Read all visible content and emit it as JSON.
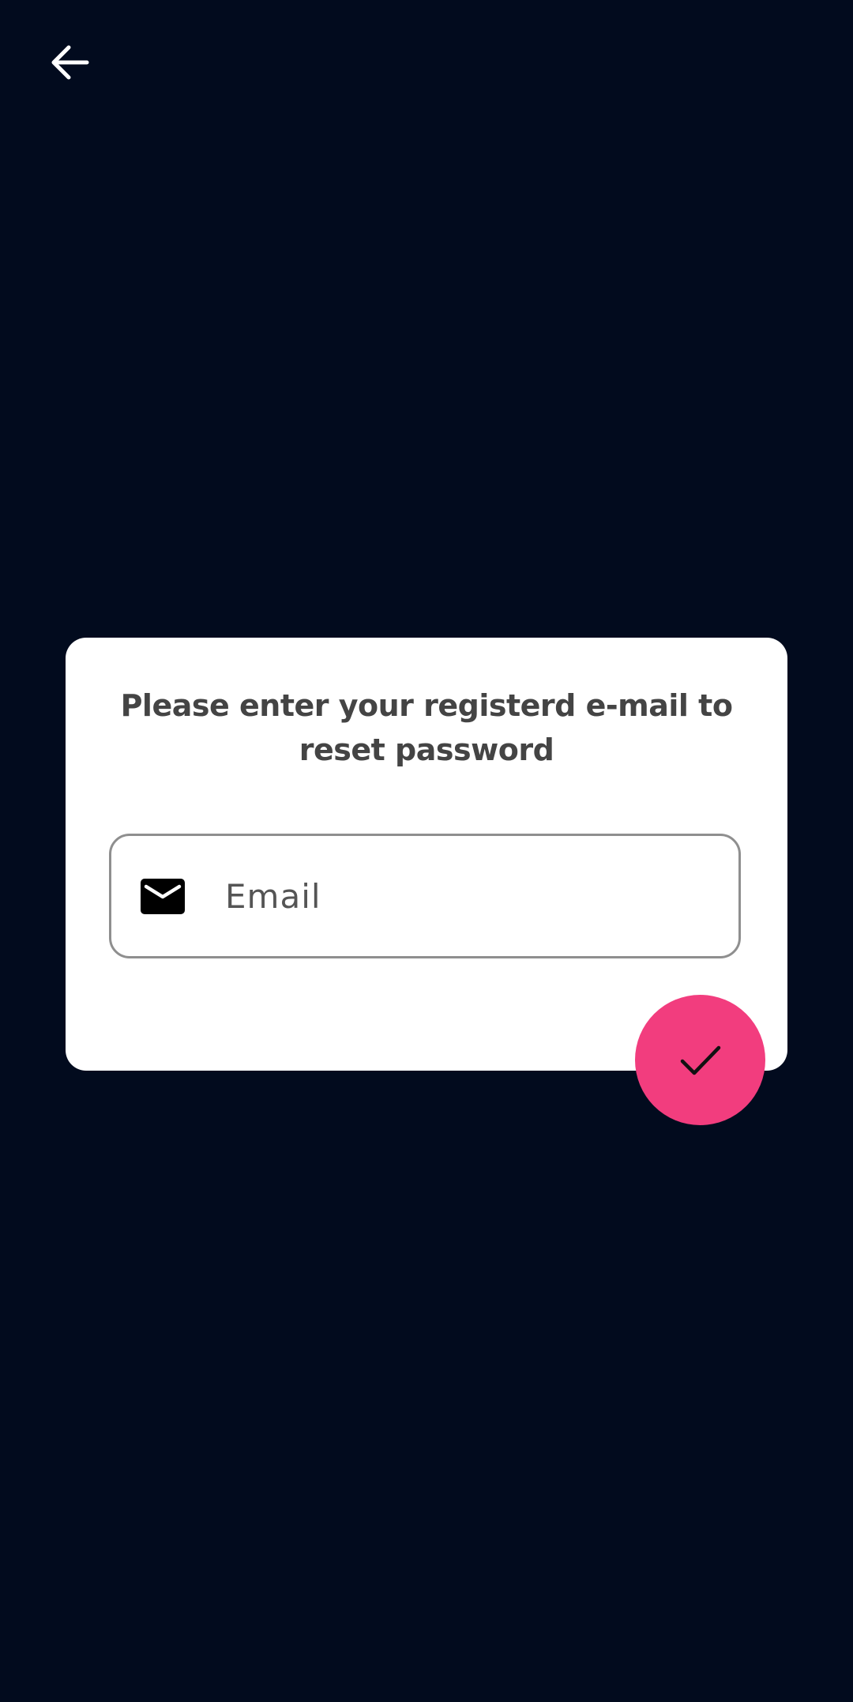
{
  "header": {
    "back_icon": "arrow-left-icon"
  },
  "reset_card": {
    "title": "Please enter your registerd e-mail to reset password",
    "email_field": {
      "icon": "envelope-icon",
      "placeholder": "Email",
      "value": ""
    },
    "submit_icon": "checkmark-icon"
  },
  "colors": {
    "background": "#020b1e",
    "card": "#ffffff",
    "accent": "#f23d7e",
    "title_text": "#444444",
    "field_border": "#8f8f8f"
  }
}
